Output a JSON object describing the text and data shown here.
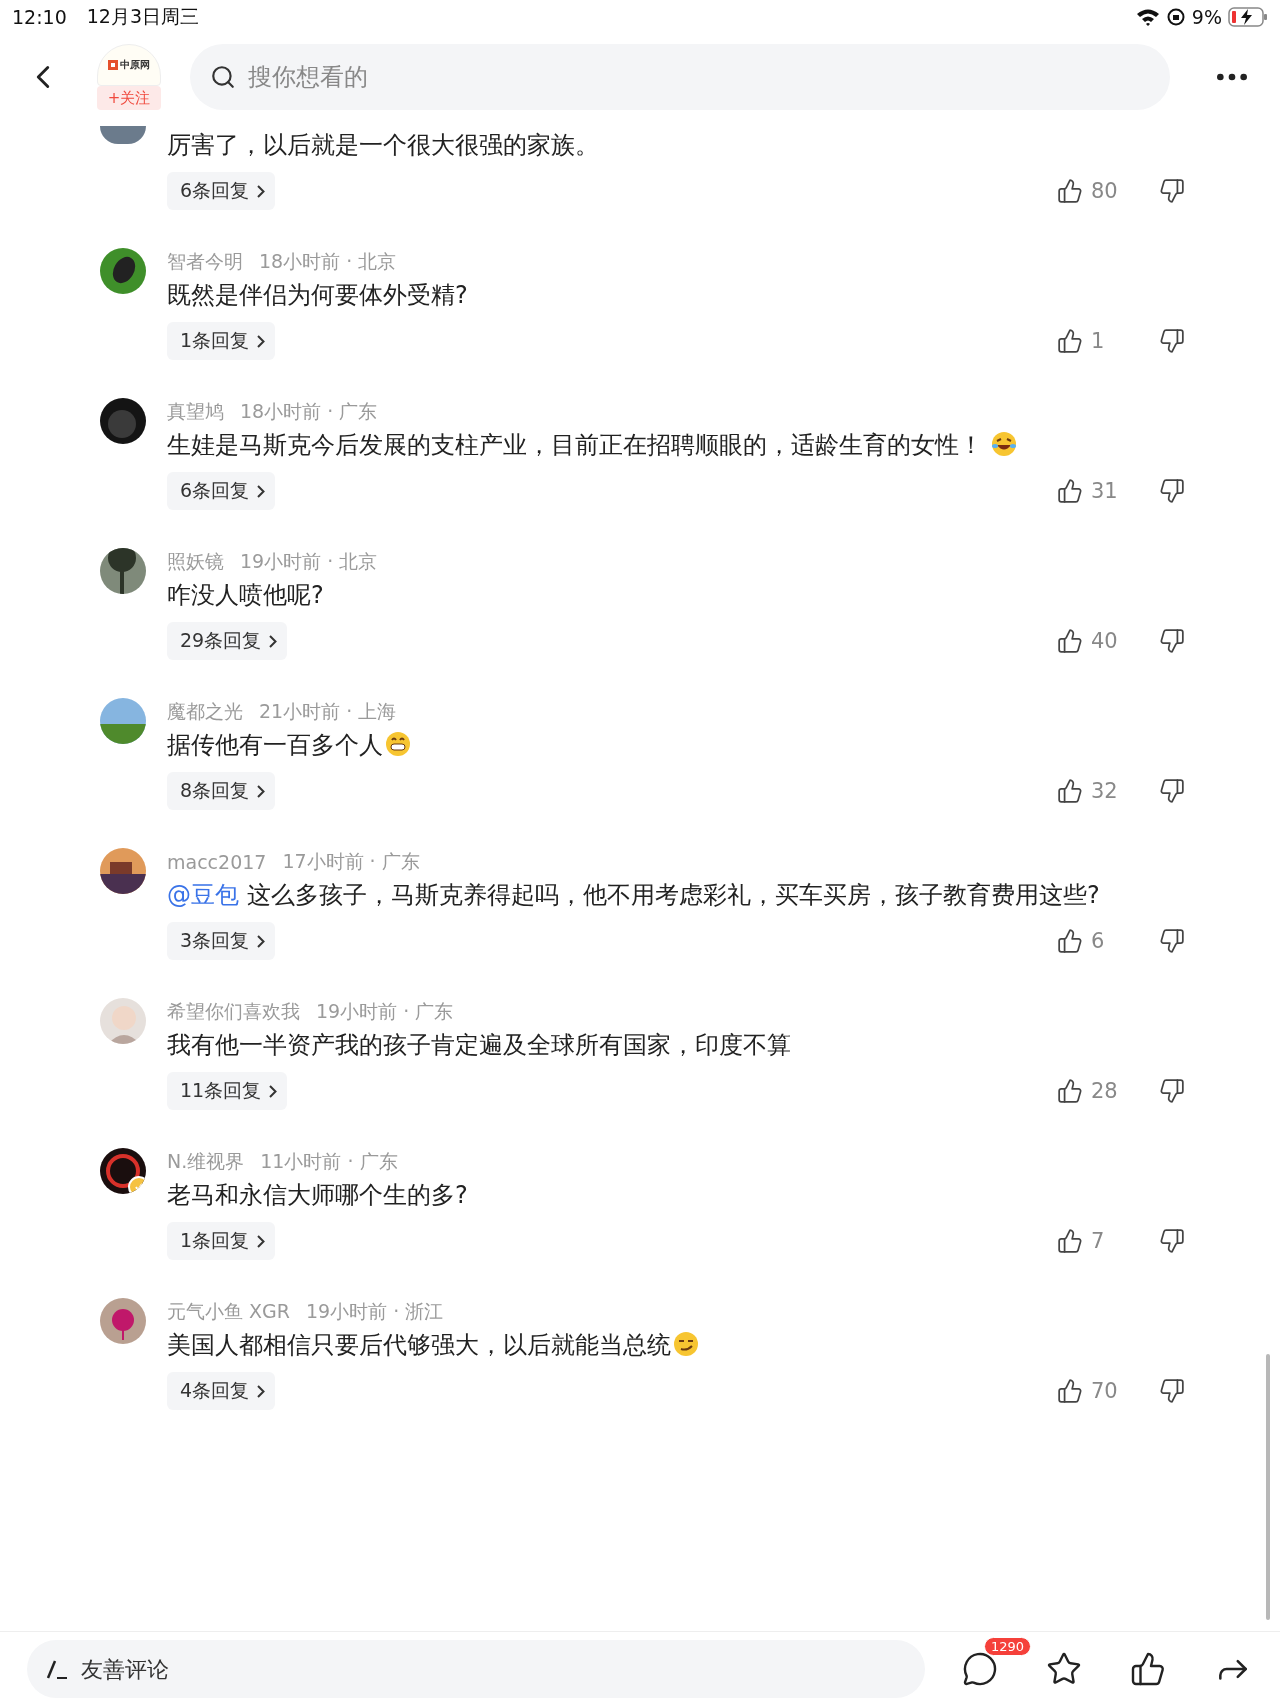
{
  "status_bar": {
    "time": "12:10",
    "date": "12月3日周三",
    "battery": "9%"
  },
  "header": {
    "logo": "中原网",
    "follow": "+关注",
    "search": {
      "placeholder": "搜你想看的"
    }
  },
  "comments": [
    {
      "body": "厉害了，以后就是一个很大很强的家族。",
      "replies": "6条回复",
      "likes": "80",
      "partial": true
    },
    {
      "author": "智者今明",
      "meta": "18小时前 · 北京",
      "body": "既然是伴侣为何要体外受精?",
      "replies": "1条回复",
      "likes": "1"
    },
    {
      "author": "真望鸠",
      "meta": "18小时前 · 广东",
      "body": "生娃是马斯克今后发展的支柱产业，目前正在招聘顺眼的，适龄生育的女性！",
      "emoji": {
        "kind": "laughing"
      },
      "replies": "6条回复",
      "likes": "31"
    },
    {
      "author": "照妖镜",
      "meta": "19小时前 · 北京",
      "body": "咋没人喷他呢?",
      "replies": "29条回复",
      "likes": "40"
    },
    {
      "author": "魔都之光",
      "meta": "21小时前 · 上海",
      "body": "据传他有一百多个人",
      "emoji": {
        "kind": "grinning"
      },
      "replies": "8条回复",
      "likes": "32"
    },
    {
      "author": "macc2017",
      "meta": "17小时前 · 广东",
      "mention": "@豆包",
      "body": "这么多孩子，马斯克养得起吗，他不用考虑彩礼，买车买房，孩子教育费用这些?",
      "replies": "3条回复",
      "likes": "6"
    },
    {
      "author": "希望你们喜欢我",
      "meta": "19小时前 · 广东",
      "body": "我有他一半资产我的孩子肯定遍及全球所有国家，印度不算",
      "replies": "11条回复",
      "likes": "28"
    },
    {
      "author": "N.维视界",
      "meta": "11小时前 · 广东",
      "body": "老马和永信大师哪个生的多?",
      "replies": "1条回复",
      "likes": "7",
      "verified": true
    },
    {
      "author": "元气小鱼 XGR",
      "meta": "19小时前 · 浙江",
      "body": "美国人都相信只要后代够强大，以后就能当总统",
      "emoji": {
        "kind": "smirk"
      },
      "replies": "4条回复",
      "likes": "70"
    }
  ],
  "bottom_bar": {
    "input": {
      "placeholder": "友善评论"
    },
    "comment_count": "1290"
  }
}
